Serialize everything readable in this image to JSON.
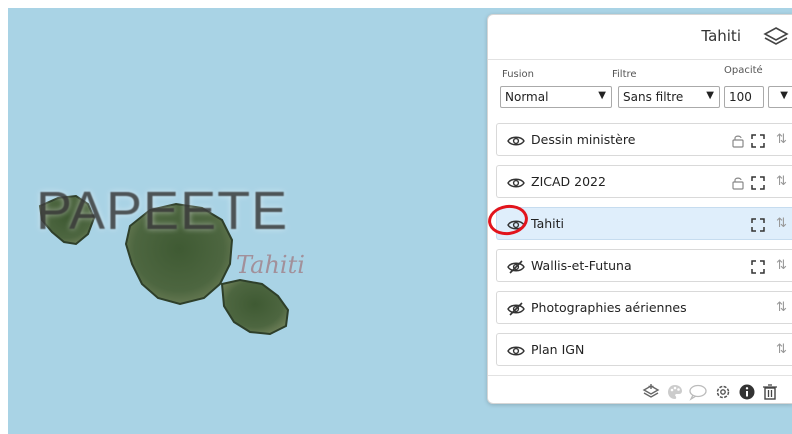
{
  "map": {
    "city_label": "PAPEETE",
    "region_label": "Tahiti"
  },
  "panel": {
    "title": "Tahiti",
    "controls": {
      "fusion_label": "Fusion",
      "fusion_value": "Normal",
      "filtre_label": "Filtre",
      "filtre_value": "Sans filtre",
      "opacite_label": "Opacité",
      "opacite_value": "100"
    },
    "layers": [
      {
        "name": "Dessin ministère",
        "visible": true,
        "lock": true,
        "expand": true,
        "active": false
      },
      {
        "name": "ZICAD 2022",
        "visible": true,
        "lock": true,
        "expand": true,
        "active": false
      },
      {
        "name": "Tahiti",
        "visible": true,
        "lock": false,
        "expand": true,
        "active": true
      },
      {
        "name": "Wallis-et-Futuna",
        "visible": false,
        "lock": false,
        "expand": true,
        "active": false
      },
      {
        "name": "Photographies aériennes",
        "visible": false,
        "lock": false,
        "expand": false,
        "active": false
      },
      {
        "name": "Plan IGN",
        "visible": true,
        "lock": false,
        "expand": false,
        "active": false
      }
    ],
    "toolbar_icons": [
      "layer-add-icon",
      "palette-icon",
      "comment-icon",
      "settings-icon",
      "info-icon",
      "delete-icon"
    ]
  },
  "colors": {
    "sea": "#a9d3e5",
    "active_layer": "#dfeefb",
    "annotation": "#e2141c"
  }
}
